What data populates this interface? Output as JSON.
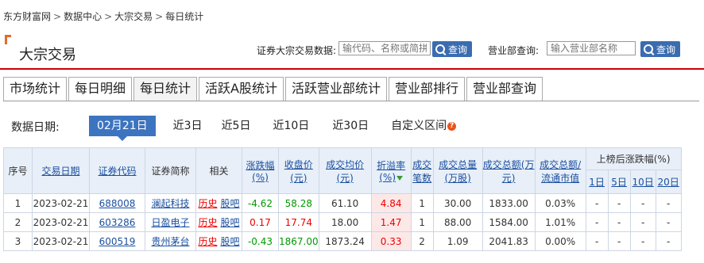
{
  "breadcrumb": [
    "东方财富网",
    "数据中心",
    "大宗交易",
    "每日统计"
  ],
  "breadcrumb_sep": ">",
  "header": {
    "title": "大宗交易",
    "stock_query_label": "证券大宗交易数据:",
    "stock_query_placeholder": "输代码、名称或简拼",
    "query_button": "查询",
    "dept_query_label": "营业部查询:",
    "dept_query_placeholder": "输入营业部名称"
  },
  "tabs": [
    "市场统计",
    "每日明细",
    "每日统计",
    "活跃A股统计",
    "活跃营业部统计",
    "营业部排行",
    "营业部查询"
  ],
  "active_tab": 2,
  "date_filter": {
    "label": "数据日期:",
    "options": [
      "02月21日",
      "近3日",
      "近5日",
      "近10日",
      "近30日",
      "自定义区间"
    ],
    "active": 0
  },
  "table": {
    "headers": {
      "seq": "序号",
      "date": "交易日期",
      "code": "证券代码",
      "name": "证券简称",
      "related": "相关",
      "change": "涨跌幅(%)",
      "close": "收盘价(元)",
      "avg_price": "成交均价(元)",
      "premium": "折溢率(%)",
      "deals": "成交笔数",
      "volume": "成交总量(万股)",
      "amount": "成交总额(万元)",
      "ratio": "成交总额/流通市值",
      "after": "上榜后涨跌幅(%)",
      "after_sub": [
        "1日",
        "5日",
        "10日",
        "20日"
      ]
    },
    "rows": [
      {
        "seq": "1",
        "date": "2023-02-21",
        "code": "688008",
        "name": "澜起科技",
        "hist": "历史",
        "bar": "股吧",
        "change": "-4.62",
        "close": "58.28",
        "avg_price": "61.10",
        "premium": "4.84",
        "deals": "1",
        "volume": "30.00",
        "amount": "1833.00",
        "ratio": "0.03%",
        "d1": "-",
        "d5": "-",
        "d10": "-",
        "d20": "-"
      },
      {
        "seq": "2",
        "date": "2023-02-21",
        "code": "603286",
        "name": "日盈电子",
        "hist": "历史",
        "bar": "股吧",
        "change": "0.17",
        "close": "17.74",
        "avg_price": "18.00",
        "premium": "1.47",
        "deals": "1",
        "volume": "88.00",
        "amount": "1584.00",
        "ratio": "1.01%",
        "d1": "-",
        "d5": "-",
        "d10": "-",
        "d20": "-"
      },
      {
        "seq": "3",
        "date": "2023-02-21",
        "code": "600519",
        "name": "贵州茅台",
        "hist": "历史",
        "bar": "股吧",
        "change": "-0.43",
        "close": "1867.00",
        "avg_price": "1873.24",
        "premium": "0.33",
        "deals": "2",
        "volume": "1.09",
        "amount": "2041.83",
        "ratio": "0.00%",
        "d1": "-",
        "d5": "-",
        "d10": "-",
        "d20": "-"
      }
    ]
  },
  "colors": {
    "accent_red": "#cc0000",
    "button_blue": "#3b6cb0",
    "up": "#ee0000",
    "down": "#009900",
    "header_bg": "#e8eff8"
  }
}
